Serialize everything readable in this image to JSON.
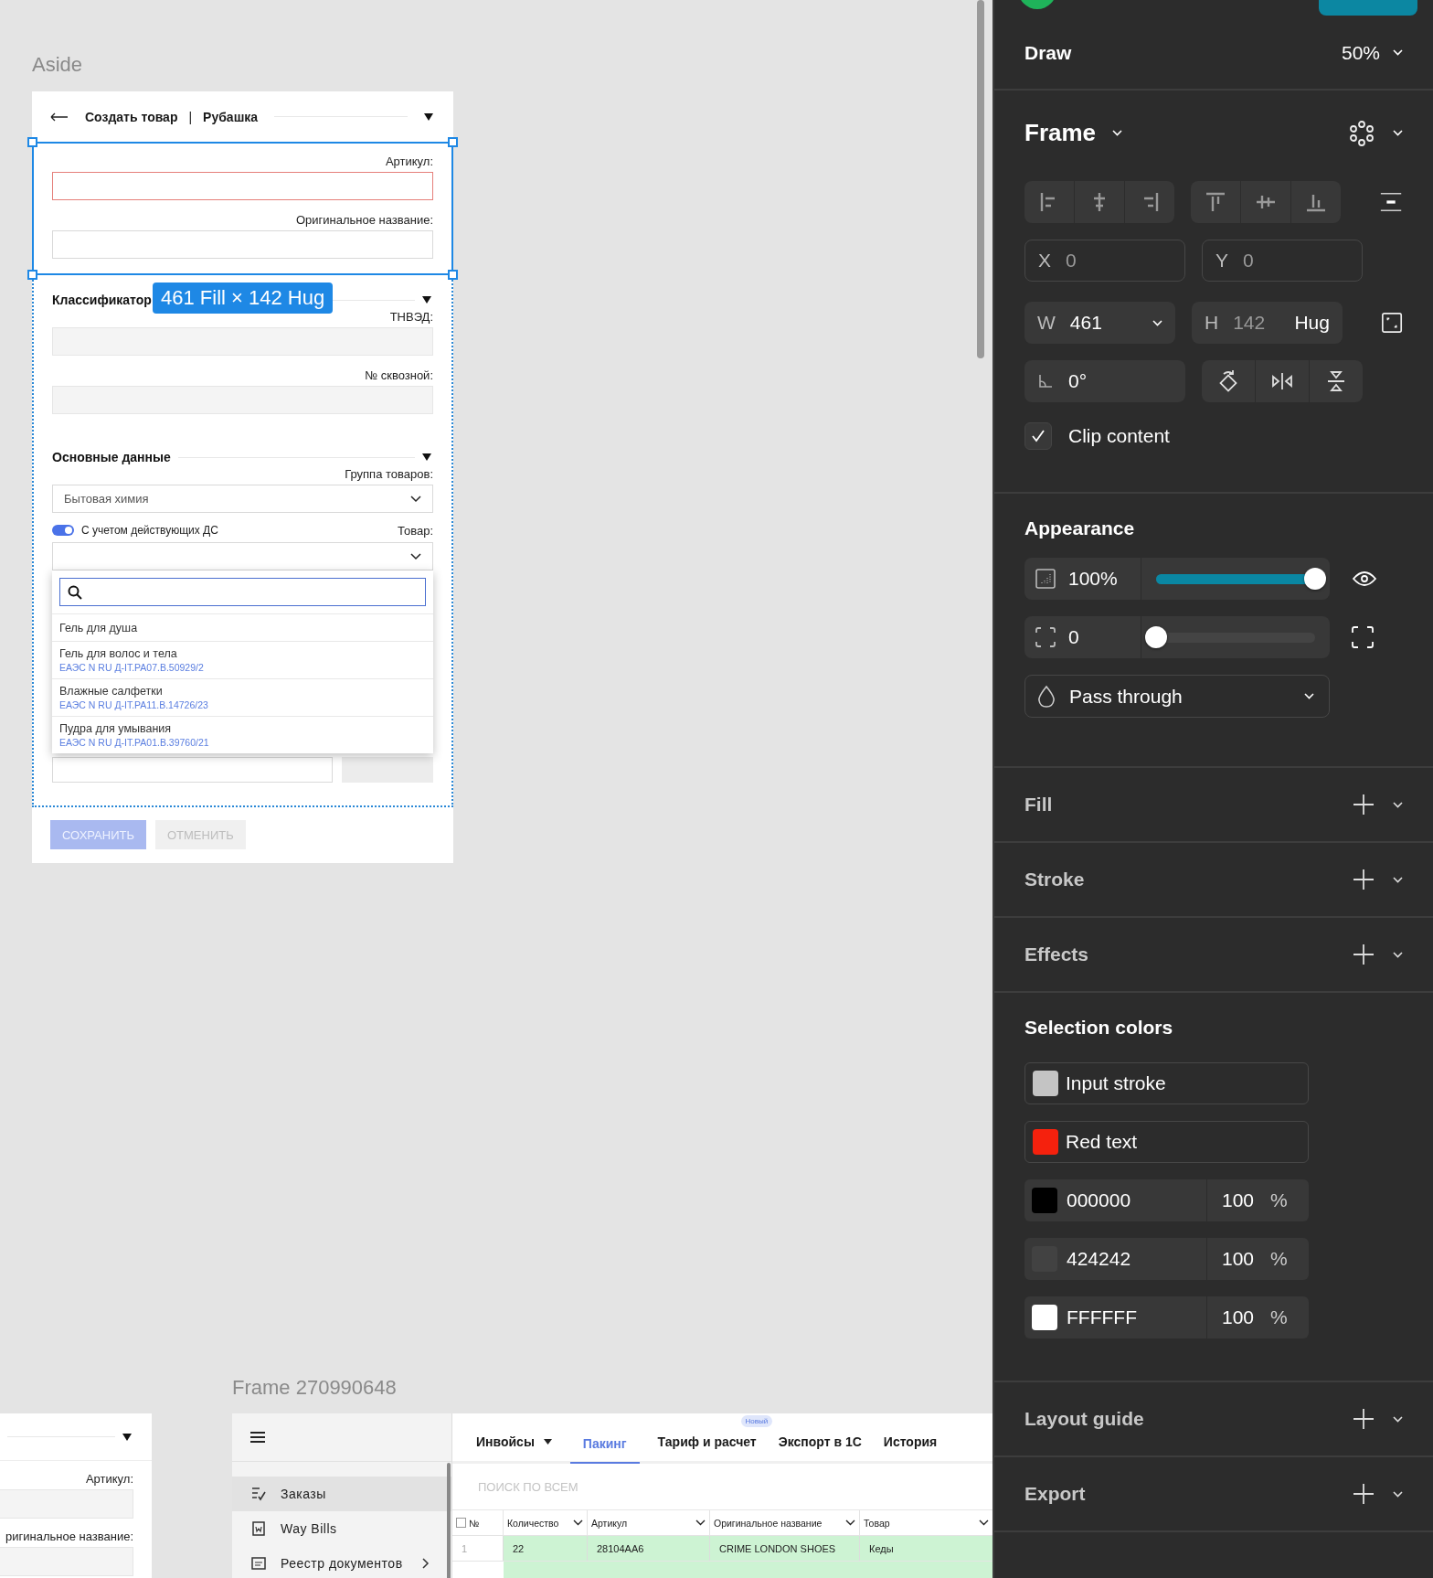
{
  "canvas": {
    "aside_frame": {
      "label": "Aside",
      "header": {
        "title": "Создать товар",
        "separator": "|",
        "subtitle": "Рубашка"
      },
      "selection": {
        "size_badge": "461 Fill × 142 Hug",
        "fields": [
          {
            "label": "Артикул:",
            "error": true
          },
          {
            "label": "Оригинальное название:",
            "error": false
          }
        ]
      },
      "classifier": {
        "title": "Классификатор",
        "fields": [
          {
            "label": "ТНВЭД:",
            "disabled": true
          },
          {
            "label": "№ сквозной:",
            "disabled": true
          }
        ]
      },
      "main_data": {
        "title": "Основные данные",
        "group_label": "Группа товаров:",
        "group_value": "Бытовая химия",
        "toggle": {
          "label": "С учетом действующих ДС",
          "on": true
        },
        "product_label": "Товар:",
        "dropdown": {
          "options": [
            {
              "name": "Гель для душа"
            },
            {
              "name": "Гель для волос и тела",
              "code": "ЕАЭС N RU Д-IT.PA07.B.50929/2"
            },
            {
              "name": "Влажные салфетки",
              "code": "ЕАЭС N RU Д-IT.PA11.B.14726/23"
            },
            {
              "name": "Пудра для умывания",
              "code": "ЕАЭС N RU Д-IT.PA01.B.39760/21"
            }
          ]
        }
      },
      "buttons": [
        {
          "label": "СОХРАНИТЬ",
          "kind": "primary",
          "disabled": true
        },
        {
          "label": "ОТМЕНИТЬ",
          "kind": "secondary",
          "disabled": true
        }
      ]
    },
    "partial_frame": {
      "fields": [
        {
          "label": "Артикул:"
        },
        {
          "label": "ригинальное название:"
        }
      ]
    },
    "orders_frame": {
      "label": "Frame 270990648",
      "menu": [
        {
          "label": "Заказы",
          "selected": true,
          "kind": "orders"
        },
        {
          "label": "Way Bills",
          "selected": false,
          "kind": "waybills"
        },
        {
          "label": "Реестр документов",
          "selected": false,
          "kind": "registry"
        }
      ],
      "tabs": [
        {
          "label": "Инвойсы",
          "selected": false,
          "dropdown": true
        },
        {
          "label": "Пакинг",
          "selected": true
        },
        {
          "label": "Тариф и расчет",
          "selected": false,
          "badge": "Новый"
        },
        {
          "label": "Экспорт в 1С",
          "selected": false
        },
        {
          "label": "История",
          "selected": false
        }
      ],
      "search": {
        "placeholder": "ПОИСК ПО ВСЕМ"
      },
      "table": {
        "checked": false,
        "columns": [
          "№",
          "Количество",
          "Артикул",
          "Оригинальное название",
          "Товар"
        ],
        "rows": [
          {
            "cells": [
              "1",
              "22",
              "28104AA6",
              "CRIME LONDON SHOES",
              "Кеды"
            ],
            "highlighted": true
          }
        ]
      }
    }
  },
  "panel": {
    "mode": "Draw",
    "zoom": "50%",
    "frame": {
      "title": "Frame",
      "x": {
        "label": "X",
        "value": "0"
      },
      "y": {
        "label": "Y",
        "value": "0"
      },
      "w": {
        "label": "W",
        "value": "461"
      },
      "h": {
        "label": "H",
        "value": "142",
        "mode": "Hug"
      },
      "rotation": "0°",
      "clip": {
        "label": "Clip content",
        "checked": true
      }
    },
    "appearance": {
      "title": "Appearance",
      "opacity": {
        "value": "100%",
        "level": 1
      },
      "radius": {
        "value": "0",
        "level": 0
      },
      "blend": "Pass through"
    },
    "sections_top": [
      {
        "title": "Fill"
      },
      {
        "title": "Stroke"
      },
      {
        "title": "Effects"
      }
    ],
    "selection_colors": {
      "title": "Selection colors",
      "items": [
        {
          "kind": "style",
          "name": "Input stroke",
          "color": "#c4c4c4"
        },
        {
          "kind": "style",
          "name": "Red text",
          "color": "#f5210d"
        },
        {
          "kind": "hex",
          "hex": "000000",
          "opacity": "100",
          "unit": "%",
          "color": "#000000"
        },
        {
          "kind": "hex",
          "hex": "424242",
          "opacity": "100",
          "unit": "%",
          "color": "#424242"
        },
        {
          "kind": "hex",
          "hex": "FFFFFF",
          "opacity": "100",
          "unit": "%",
          "color": "#ffffff"
        }
      ]
    },
    "sections_bottom": [
      {
        "title": "Layout guide"
      },
      {
        "title": "Export"
      }
    ]
  }
}
